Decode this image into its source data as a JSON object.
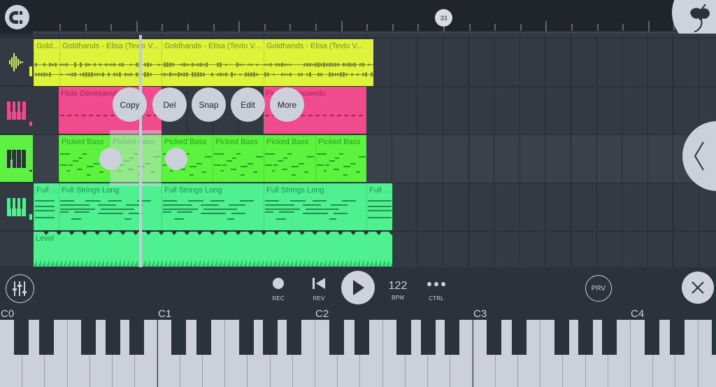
{
  "ruler": {
    "bar_bubble": "33",
    "magnet_icon": "magnet-snap-icon",
    "logo_icon": "fl-studio-fruit-logo-icon"
  },
  "tracks": [
    {
      "type": "audio",
      "icon": "waveform-icon",
      "color": "#dcf43a",
      "icon_color": "#dcf43a"
    },
    {
      "type": "instrument",
      "icon": "piano-icon",
      "color": "#f04b8c",
      "icon_color": "#f04b8c"
    },
    {
      "type": "instrument",
      "icon": "piano-icon",
      "color": "#5cf33e",
      "icon_color": "#2b323b",
      "selected": true
    },
    {
      "type": "instrument",
      "icon": "piano-icon",
      "color": "#4ff08f",
      "icon_color": "#4ff08f"
    },
    {
      "type": "automation",
      "icon": "",
      "color": "#4ff08f"
    }
  ],
  "clips": {
    "audio": [
      "Gold...",
      "Goldhands - Elisa (Tevlo V...",
      "Goldhands - Elisa (Tevlo V...",
      "Goldhands - Elisa (Tevlo V..."
    ],
    "flute": [
      "Flute Diminuendo",
      "Flute Diminuendo"
    ],
    "bass": [
      "Picked Bass",
      "Picked Bass",
      "Picked Bass",
      "Picked Bass",
      "Picked Bass",
      "Picked Bass"
    ],
    "strings": [
      "Full ...",
      "Full Strings Long",
      "Full Strings Long",
      "Full Strings Long",
      "Full ..."
    ],
    "automation": [
      "Level"
    ]
  },
  "context_menu": {
    "copy": "Copy",
    "delete": "Del",
    "snap": "Snap",
    "edit": "Edit",
    "more": "More"
  },
  "toolbar": {
    "rec_label": "REC",
    "rev_label": "REV",
    "bpm_value": "122",
    "bpm_label": "BPM",
    "ctrl_label": "CTRL",
    "prv_label": "PRV"
  },
  "piano": {
    "octave_labels": [
      "C0",
      "C1",
      "C2",
      "C3",
      "C4"
    ]
  },
  "colors": {
    "background": "#2b323b",
    "audio_clip": "#dcf43a",
    "flute_clip": "#f04b8c",
    "bass_clip": "#5cf33e",
    "strings_clip": "#4ff08f",
    "button_light": "#cdd2dc"
  }
}
